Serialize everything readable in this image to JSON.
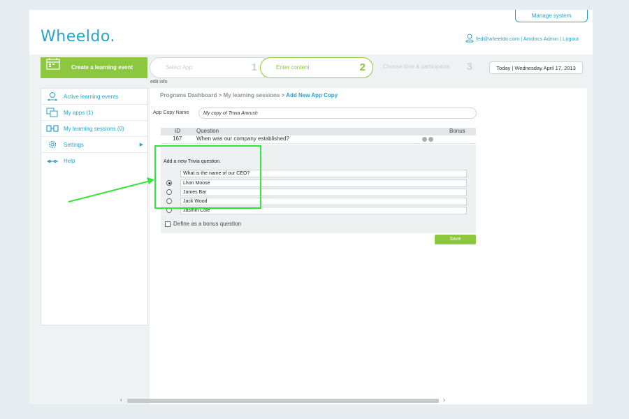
{
  "header": {
    "logo": "Wheeldo.",
    "manage_system": "Manage system",
    "user_links": "fed@wheeldo.com | Amdocs Admin | Logout"
  },
  "wizard": {
    "create_label": "Create a learning event",
    "steps": [
      {
        "label": "Select App",
        "num": "1"
      },
      {
        "label": "Enter content",
        "num": "2"
      },
      {
        "label": "Choose time & participants",
        "num": "3"
      }
    ],
    "today": "Today | Wednesday April 17, 2013"
  },
  "edit_info": "edit info",
  "sidebar": {
    "items": [
      {
        "label": "Active learning events",
        "icon": "active-events-icon"
      },
      {
        "label": "My apps (1)",
        "icon": "apps-icon"
      },
      {
        "label": "My learning sessions (0)",
        "icon": "sessions-icon"
      },
      {
        "label": "Settings",
        "icon": "gear-icon"
      },
      {
        "label": "Help",
        "icon": "help-icon"
      }
    ]
  },
  "main": {
    "breadcrumb": {
      "path": "Programs Dashboard > My learning sessions > ",
      "current": "Add New App Copy"
    },
    "copy_name_label": "App Copy Name",
    "copy_name_value": "My copy of Trivia Anirush",
    "table": {
      "headers": {
        "id": "ID",
        "question": "Question",
        "bonus": "Bonus"
      },
      "rows": [
        {
          "id": "167",
          "question": "When was our company established?"
        }
      ]
    },
    "new_question": {
      "title": "Add a new Trivia question.",
      "question_value": "What is the name of our CEO?",
      "answers": [
        {
          "value": "Lhon Moose",
          "selected": true
        },
        {
          "value": "James Bar",
          "selected": false
        },
        {
          "value": "Jack Wood",
          "selected": false
        },
        {
          "value": "Jasmin Cole",
          "selected": false
        }
      ],
      "bonus_label": "Define as a bonus question"
    },
    "save_label": "Save"
  },
  "colors": {
    "accent_blue": "#2aa1c6",
    "accent_green": "#8dc63f",
    "highlight": "#33e63a"
  }
}
